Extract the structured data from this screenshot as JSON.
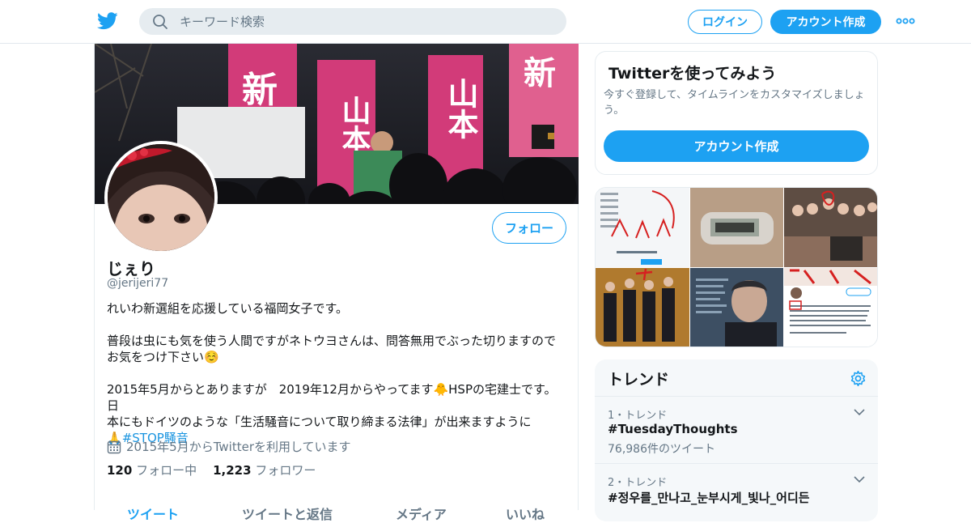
{
  "header": {
    "search_placeholder": "キーワード検索",
    "login_label": "ログイン",
    "signup_label": "アカウント作成"
  },
  "profile": {
    "name": "じぇり",
    "handle": "@jerijeri77",
    "follow_label": "フォロー",
    "bio_line1": "れいわ新選組を応援している福岡女子です。",
    "bio_line2": "普段は虫にも気を使う人間ですがネトウヨさんは、問答無用でぶった切りますので",
    "bio_line3": "お気をつけ下さい☺️",
    "bio_line4": "2015年5月からとありますが　2019年12月からやってます🐥HSPの宅建士です。日",
    "bio_line5": "本にもドイツのような「生活騒音について取り締まる法律」が出来ますように",
    "bio_line6_prefix": "🙏",
    "bio_hashtag": "#STOP騒音",
    "joined": "2015年5月からTwitterを利用しています",
    "following_count": "120",
    "following_label": "フォロー中",
    "followers_count": "1,223",
    "followers_label": "フォロワー",
    "tabs": [
      "ツイート",
      "ツイートと返信",
      "メディア",
      "いいね"
    ]
  },
  "signup_card": {
    "title": "Twitterを使ってみよう",
    "subtitle": "今すぐ登録して、タイムラインをカスタマイズしましょう。",
    "cta": "アカウント作成"
  },
  "trends": {
    "title": "トレンド",
    "items": [
      {
        "rank": "1・トレンド",
        "name": "#TuesdayThoughts",
        "count": "76,986件のツイート"
      },
      {
        "rank": "2・トレンド",
        "name": "#정우를_만나고_눈부시게_빛나_어디든",
        "count": ""
      }
    ]
  },
  "banner_signs": [
    "新",
    "山本",
    "山本",
    "新"
  ],
  "colors": {
    "accent": "#1da1f2",
    "text_secondary": "#657786",
    "border": "#e6ecf0"
  },
  "icons": {
    "logo": "twitter-bird-icon",
    "search": "search-icon",
    "more": "more-dots-icon",
    "calendar": "calendar-icon",
    "settings": "gear-icon",
    "chevron": "chevron-down-icon"
  }
}
